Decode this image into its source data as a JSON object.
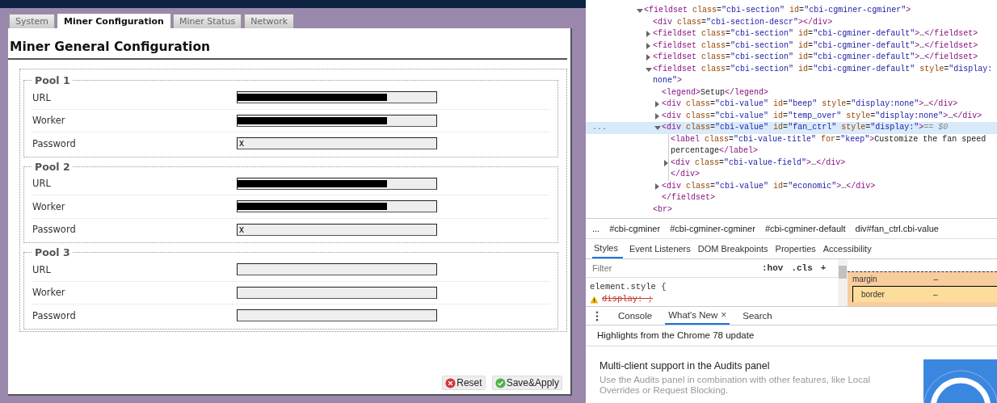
{
  "tabs": [
    {
      "label": "System",
      "selected": false
    },
    {
      "label": "Miner Configuration",
      "selected": true
    },
    {
      "label": "Miner Status",
      "selected": false
    },
    {
      "label": "Network",
      "selected": false
    }
  ],
  "page_title": "Miner General Configuration",
  "pools": [
    {
      "legend": "Pool 1",
      "fields": [
        {
          "label": "URL",
          "redacted": true
        },
        {
          "label": "Worker",
          "redacted": true
        },
        {
          "label": "Password",
          "value": "x",
          "redacted": false
        }
      ]
    },
    {
      "legend": "Pool 2",
      "fields": [
        {
          "label": "URL",
          "redacted": true
        },
        {
          "label": "Worker",
          "redacted": true
        },
        {
          "label": "Password",
          "value": "x",
          "redacted": false
        }
      ]
    },
    {
      "legend": "Pool 3",
      "fields": [
        {
          "label": "URL",
          "redacted": false
        },
        {
          "label": "Worker",
          "redacted": false
        },
        {
          "label": "Password",
          "redacted": false
        }
      ]
    }
  ],
  "buttons": [
    {
      "label": "Reset",
      "kind": "reset"
    },
    {
      "label": "Save&Apply",
      "kind": "apply"
    }
  ],
  "devtools": {
    "dom_tree": [
      {
        "kind": "node",
        "text": "<fieldset class=\"cbi-section\" id=\"cbi-cgminer-cgminer\">",
        "expanded": true,
        "selected": false,
        "children": [
          {
            "kind": "leaf",
            "text": "<div class=\"cbi-section-descr\"></div>",
            "selected": false
          },
          {
            "kind": "node",
            "text": "<fieldset class=\"cbi-section\" id=\"cbi-cgminer-default\">…</fieldset>",
            "expanded": false,
            "selected": false
          },
          {
            "kind": "node",
            "text": "<fieldset class=\"cbi-section\" id=\"cbi-cgminer-default\">…</fieldset>",
            "expanded": false,
            "selected": false
          },
          {
            "kind": "node",
            "text": "<fieldset class=\"cbi-section\" id=\"cbi-cgminer-default\">…</fieldset>",
            "expanded": false,
            "selected": false
          },
          {
            "kind": "node",
            "text": "<fieldset class=\"cbi-section\" id=\"cbi-cgminer-default\" style=\"display: none\">",
            "expanded": true,
            "selected": false,
            "close": "</fieldset>",
            "children": [
              {
                "kind": "leaf",
                "text": "<legend>Setup</legend>",
                "selected": false
              },
              {
                "kind": "node",
                "text": "<div class=\"cbi-value\" id=\"beep\" style=\"display:none\">…</div>",
                "expanded": false,
                "selected": false
              },
              {
                "kind": "node",
                "text": "<div class=\"cbi-value\" id=\"temp_over\" style=\"display:none\">…</div>",
                "expanded": false,
                "selected": false
              },
              {
                "kind": "node",
                "text": "<div class=\"cbi-value\" id=\"fan_ctrl\" style=\"display:\">",
                "expanded": true,
                "selected": true,
                "marker": "...",
                "suffix": "== $0",
                "close": "</div>",
                "children": [
                  {
                    "kind": "leaf",
                    "text": "<label class=\"cbi-value-title\" for=\"keep\">Customize the fan speed percentage</label>",
                    "selected": false
                  },
                  {
                    "kind": "node",
                    "text": "<div class=\"cbi-value-field\">…</div>",
                    "expanded": false,
                    "selected": false
                  }
                ]
              },
              {
                "kind": "node",
                "text": "<div class=\"cbi-value\" id=\"economic\">…</div>",
                "expanded": false,
                "selected": false
              }
            ]
          },
          {
            "kind": "leaf",
            "text": "<br>",
            "selected": false
          }
        ]
      }
    ],
    "breadcrumbs": [
      "...",
      "#cbi-cgminer",
      "#cbi-cgminer-cgminer",
      "#cbi-cgminer-default",
      "div#fan_ctrl.cbi-value"
    ],
    "panel_tabs": [
      {
        "label": "Styles",
        "selected": true
      },
      {
        "label": "Event Listeners",
        "selected": false
      },
      {
        "label": "DOM Breakpoints",
        "selected": false
      },
      {
        "label": "Properties",
        "selected": false
      },
      {
        "label": "Accessibility",
        "selected": false
      }
    ],
    "filter": {
      "placeholder": "Filter"
    },
    "filter_buttons": [
      ":hov",
      ".cls",
      "+"
    ],
    "style_rule": {
      "selector": "element.style {",
      "declarations": [
        {
          "text": "display: ;",
          "invalid": true
        }
      ]
    },
    "box_model": {
      "margin_label": "margin",
      "margin_value": "–",
      "border_label": "border",
      "border_value": "–"
    },
    "drawer_tabs": [
      {
        "label": "Console",
        "selected": false
      },
      {
        "label": "What's New",
        "selected": true,
        "close": "×"
      },
      {
        "label": "Search",
        "selected": false
      }
    ],
    "drawer_header": "Highlights from the Chrome 78 update",
    "article": {
      "title": "Multi-client support in the Audits panel",
      "description": "Use the Audits panel in combination with other features, like Local Overrides or Request Blocking."
    }
  }
}
